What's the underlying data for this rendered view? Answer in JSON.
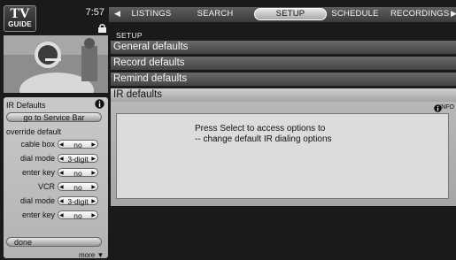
{
  "header": {
    "logo_line1": "TV",
    "logo_line2": "GUIDE",
    "time": "7:57"
  },
  "topnav": {
    "items": [
      {
        "label": "LISTINGS"
      },
      {
        "label": "SEARCH"
      },
      {
        "label": "SETUP",
        "active": true
      },
      {
        "label": "SCHEDULE"
      },
      {
        "label": "RECORDINGS"
      }
    ]
  },
  "left_panel": {
    "title": "IR Defaults",
    "service_bar_button": "go to Service Bar",
    "override_label": "override default",
    "options": [
      {
        "label": "cable box",
        "value": "no"
      },
      {
        "label": "dial mode",
        "value": "3-digit"
      },
      {
        "label": "enter key",
        "value": "no"
      },
      {
        "label": "VCR",
        "value": "no"
      },
      {
        "label": "dial mode",
        "value": "3-digit"
      },
      {
        "label": "enter key",
        "value": "no"
      }
    ],
    "done_button": "done",
    "more_label": "more"
  },
  "main": {
    "section_title": "SETUP",
    "menu_items": [
      {
        "label": "General defaults"
      },
      {
        "label": "Record defaults"
      },
      {
        "label": "Remind defaults"
      },
      {
        "label": "IR defaults",
        "active": true
      }
    ],
    "info_label": "INFO",
    "message_lines": [
      "Press Select to access options to",
      "-- change default IR dialing options"
    ]
  }
}
